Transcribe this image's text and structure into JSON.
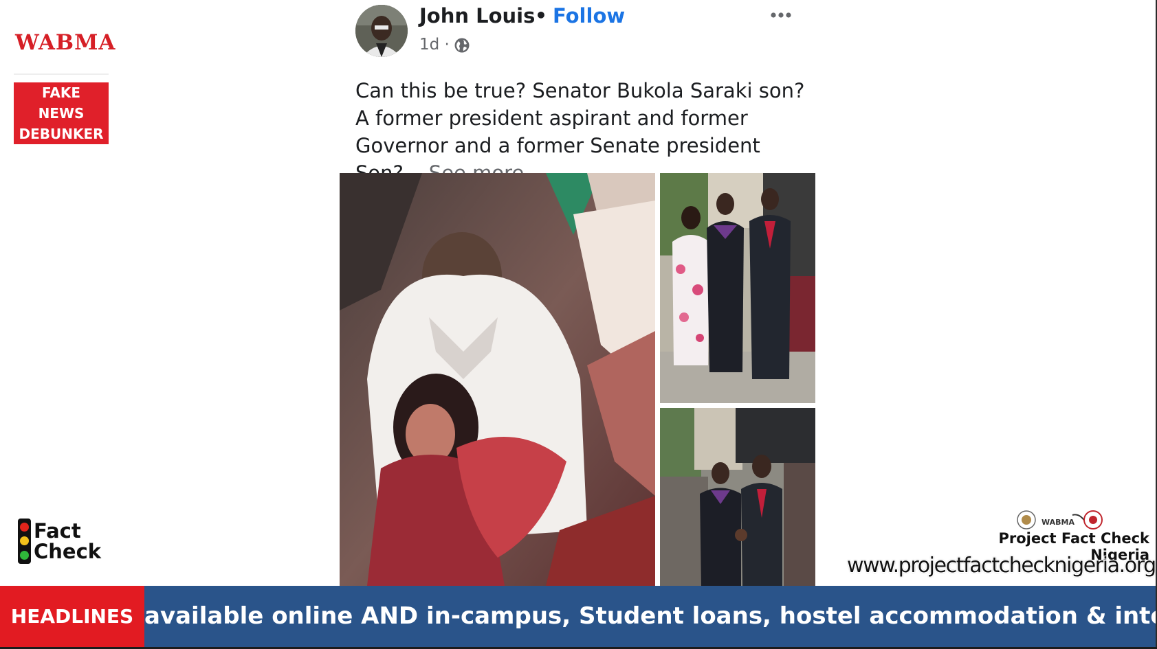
{
  "branding": {
    "logo_text": "WABMA",
    "badge_lines": [
      "FAKE",
      "NEWS",
      "DEBUNKER"
    ],
    "fact_check_lines": [
      "Fact",
      "Check"
    ],
    "project_name": "Project Fact Check Nigeria",
    "website": "www.projectfactchecknigeria.org",
    "partner_logo_text": "WABMA"
  },
  "post": {
    "author": "John Louis",
    "separator": "•",
    "follow_label": "Follow",
    "age": "1d ·",
    "caption": "Can this be true? Senator Bukola Saraki son?  A former president aspirant and former Governor and a former Senate president Son?...",
    "see_more_label": "See more",
    "icons": {
      "avatar": "author-avatar",
      "privacy": "globe-icon",
      "options": "more-options-icon"
    }
  },
  "ticker": {
    "label": "HEADLINES",
    "text": "available online AND in-campus,  Student loans, hostel accommodation & internship opportu"
  },
  "colors": {
    "brand_red": "#e0202a",
    "follow_blue": "#1b74e4",
    "ticker_blue": "#2a548a",
    "ticker_label_red": "#e21b22"
  }
}
